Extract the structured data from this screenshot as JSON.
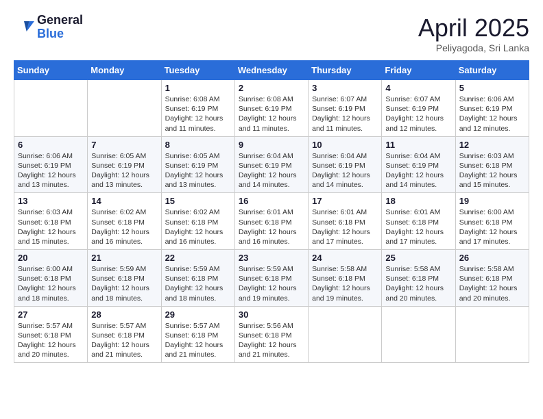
{
  "header": {
    "logo_general": "General",
    "logo_blue": "Blue",
    "month_title": "April 2025",
    "location": "Peliyagoda, Sri Lanka"
  },
  "weekdays": [
    "Sunday",
    "Monday",
    "Tuesday",
    "Wednesday",
    "Thursday",
    "Friday",
    "Saturday"
  ],
  "weeks": [
    [
      {
        "day": "",
        "info": ""
      },
      {
        "day": "",
        "info": ""
      },
      {
        "day": "1",
        "info": "Sunrise: 6:08 AM\nSunset: 6:19 PM\nDaylight: 12 hours and 11 minutes."
      },
      {
        "day": "2",
        "info": "Sunrise: 6:08 AM\nSunset: 6:19 PM\nDaylight: 12 hours and 11 minutes."
      },
      {
        "day": "3",
        "info": "Sunrise: 6:07 AM\nSunset: 6:19 PM\nDaylight: 12 hours and 11 minutes."
      },
      {
        "day": "4",
        "info": "Sunrise: 6:07 AM\nSunset: 6:19 PM\nDaylight: 12 hours and 12 minutes."
      },
      {
        "day": "5",
        "info": "Sunrise: 6:06 AM\nSunset: 6:19 PM\nDaylight: 12 hours and 12 minutes."
      }
    ],
    [
      {
        "day": "6",
        "info": "Sunrise: 6:06 AM\nSunset: 6:19 PM\nDaylight: 12 hours and 13 minutes."
      },
      {
        "day": "7",
        "info": "Sunrise: 6:05 AM\nSunset: 6:19 PM\nDaylight: 12 hours and 13 minutes."
      },
      {
        "day": "8",
        "info": "Sunrise: 6:05 AM\nSunset: 6:19 PM\nDaylight: 12 hours and 13 minutes."
      },
      {
        "day": "9",
        "info": "Sunrise: 6:04 AM\nSunset: 6:19 PM\nDaylight: 12 hours and 14 minutes."
      },
      {
        "day": "10",
        "info": "Sunrise: 6:04 AM\nSunset: 6:19 PM\nDaylight: 12 hours and 14 minutes."
      },
      {
        "day": "11",
        "info": "Sunrise: 6:04 AM\nSunset: 6:19 PM\nDaylight: 12 hours and 14 minutes."
      },
      {
        "day": "12",
        "info": "Sunrise: 6:03 AM\nSunset: 6:18 PM\nDaylight: 12 hours and 15 minutes."
      }
    ],
    [
      {
        "day": "13",
        "info": "Sunrise: 6:03 AM\nSunset: 6:18 PM\nDaylight: 12 hours and 15 minutes."
      },
      {
        "day": "14",
        "info": "Sunrise: 6:02 AM\nSunset: 6:18 PM\nDaylight: 12 hours and 16 minutes."
      },
      {
        "day": "15",
        "info": "Sunrise: 6:02 AM\nSunset: 6:18 PM\nDaylight: 12 hours and 16 minutes."
      },
      {
        "day": "16",
        "info": "Sunrise: 6:01 AM\nSunset: 6:18 PM\nDaylight: 12 hours and 16 minutes."
      },
      {
        "day": "17",
        "info": "Sunrise: 6:01 AM\nSunset: 6:18 PM\nDaylight: 12 hours and 17 minutes."
      },
      {
        "day": "18",
        "info": "Sunrise: 6:01 AM\nSunset: 6:18 PM\nDaylight: 12 hours and 17 minutes."
      },
      {
        "day": "19",
        "info": "Sunrise: 6:00 AM\nSunset: 6:18 PM\nDaylight: 12 hours and 17 minutes."
      }
    ],
    [
      {
        "day": "20",
        "info": "Sunrise: 6:00 AM\nSunset: 6:18 PM\nDaylight: 12 hours and 18 minutes."
      },
      {
        "day": "21",
        "info": "Sunrise: 5:59 AM\nSunset: 6:18 PM\nDaylight: 12 hours and 18 minutes."
      },
      {
        "day": "22",
        "info": "Sunrise: 5:59 AM\nSunset: 6:18 PM\nDaylight: 12 hours and 18 minutes."
      },
      {
        "day": "23",
        "info": "Sunrise: 5:59 AM\nSunset: 6:18 PM\nDaylight: 12 hours and 19 minutes."
      },
      {
        "day": "24",
        "info": "Sunrise: 5:58 AM\nSunset: 6:18 PM\nDaylight: 12 hours and 19 minutes."
      },
      {
        "day": "25",
        "info": "Sunrise: 5:58 AM\nSunset: 6:18 PM\nDaylight: 12 hours and 20 minutes."
      },
      {
        "day": "26",
        "info": "Sunrise: 5:58 AM\nSunset: 6:18 PM\nDaylight: 12 hours and 20 minutes."
      }
    ],
    [
      {
        "day": "27",
        "info": "Sunrise: 5:57 AM\nSunset: 6:18 PM\nDaylight: 12 hours and 20 minutes."
      },
      {
        "day": "28",
        "info": "Sunrise: 5:57 AM\nSunset: 6:18 PM\nDaylight: 12 hours and 21 minutes."
      },
      {
        "day": "29",
        "info": "Sunrise: 5:57 AM\nSunset: 6:18 PM\nDaylight: 12 hours and 21 minutes."
      },
      {
        "day": "30",
        "info": "Sunrise: 5:56 AM\nSunset: 6:18 PM\nDaylight: 12 hours and 21 minutes."
      },
      {
        "day": "",
        "info": ""
      },
      {
        "day": "",
        "info": ""
      },
      {
        "day": "",
        "info": ""
      }
    ]
  ]
}
